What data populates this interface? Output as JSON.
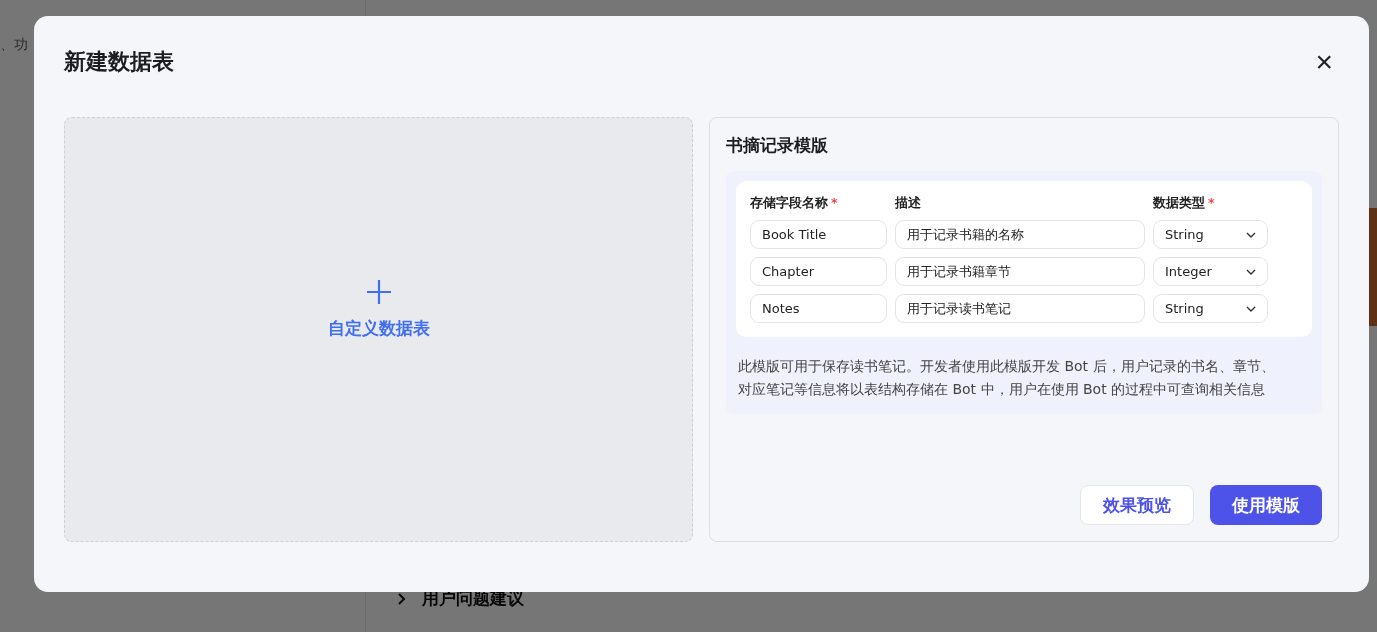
{
  "background": {
    "side_text": "、功",
    "section_title": "用户问题建议"
  },
  "dialog": {
    "title": "新建数据表",
    "close": "×",
    "custom_card": {
      "label": "自定义数据表"
    },
    "template": {
      "title": "书摘记录模版",
      "required_mark": "*",
      "columns": [
        {
          "label": "存储字段名称",
          "required": true
        },
        {
          "label": "描述",
          "required": false
        },
        {
          "label": "数据类型",
          "required": true
        }
      ],
      "rows": [
        {
          "name": "Book Title",
          "description": "用于记录书籍的名称",
          "type": "String"
        },
        {
          "name": "Chapter",
          "description": "用于记录书籍章节",
          "type": "Integer"
        },
        {
          "name": "Notes",
          "description": "用于记录读书笔记",
          "type": "String"
        }
      ],
      "description": "此模版可用于保存读书笔记。开发者使用此模版开发 Bot 后，用户记录的书名、章节、对应笔记等信息将以表结构存储在 Bot 中，用户在使用 Bot 的过程中可查询相关信息",
      "buttons": [
        {
          "label": "效果预览",
          "kind": "secondary"
        },
        {
          "label": "使用模版",
          "kind": "primary"
        }
      ]
    }
  }
}
